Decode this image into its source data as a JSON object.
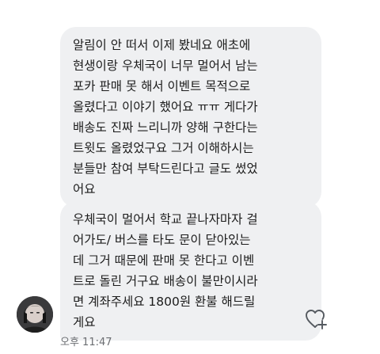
{
  "conversation": {
    "messages": [
      {
        "text": "알림이 안 떠서 이제 봤네요 애초에\n현생이랑 우체국이 너무 멀어서 남는\n포카 판매 못 해서 이벤트 목적으로\n올렸다고 이야기 했어요 ㅠㅠ 게다가\n배송도 진짜 느리니까 양해 구한다는\n트윗도 올렸었구요  그거 이해하시는\n분들만 참여 부탁드린다고 글도 썼었\n어요"
      },
      {
        "text": "우체국이 멀어서 학교 끝나자마자 걸\n어가도/ 버스를 타도 문이 닫아있는\n데 그거 때문에 판매 못 한다고 이벤\n트로 돌린 거구요 배송이 불만이시라\n면 계좌주세요 1800원 환불 해드릴\n게요"
      }
    ],
    "timestamp": "오후 11:47",
    "avatar_icon": "profile-photo",
    "reaction_icon": "heart-plus-icon",
    "bubble_color": "#eff0f2",
    "timestamp_color": "#6b6e72"
  }
}
